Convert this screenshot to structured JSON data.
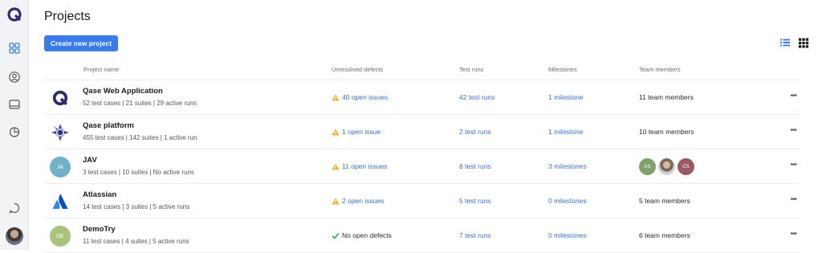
{
  "page": {
    "title": "Projects"
  },
  "toolbar": {
    "create_label": "Create new project"
  },
  "columns": {
    "name": "Project name",
    "defects": "Unresolved defects",
    "runs": "Test runs",
    "milestones": "Milestones",
    "team": "Team members"
  },
  "projects": [
    {
      "name": "Qase Web Application",
      "desc": "52 test cases | 21 suites | 29 active runs",
      "defects": "40 open issues",
      "runs": "42 test runs",
      "milestones": "1 milestone",
      "team": "11 team members"
    },
    {
      "name": "Qase platform",
      "desc": "455 test cases | 142 suites | 1 active run",
      "defects": "1 open issue",
      "runs": "2 test runs",
      "milestones": "1 milestone",
      "team": "10 team members"
    },
    {
      "name": "JAV",
      "initials": "JA",
      "desc": "3 test cases | 10 suites | No active runs",
      "defects": "11 open issues",
      "runs": "8 test runs",
      "milestones": "3 milestones",
      "avatars": [
        "AS",
        "",
        "CS"
      ]
    },
    {
      "name": "Atlassian",
      "desc": "14 test cases | 3 suites | 5 active runs",
      "defects": "2 open issues",
      "runs": "5 test runs",
      "milestones": "0 milestones",
      "team": "5 team members"
    },
    {
      "name": "DemoTry",
      "initials": "DE",
      "desc": "11 test cases | 4 suites | 5 active runs",
      "defects": "No open defects",
      "runs": "7 test runs",
      "milestones": "0 milestones",
      "team": "6 team members"
    }
  ],
  "colors": {
    "accent": "#3a7bf0",
    "link": "#3a6fd8",
    "warning": "#f0b429",
    "success": "#2ea44f",
    "brand": "#2b2d6e"
  },
  "icons": [
    "qase-logo-icon",
    "projects-grid-icon",
    "user-circle-icon",
    "monitor-icon",
    "pie-chart-icon",
    "chat-icon",
    "list-view-icon",
    "grid-view-icon",
    "warning-icon",
    "check-icon",
    "more-icon"
  ]
}
